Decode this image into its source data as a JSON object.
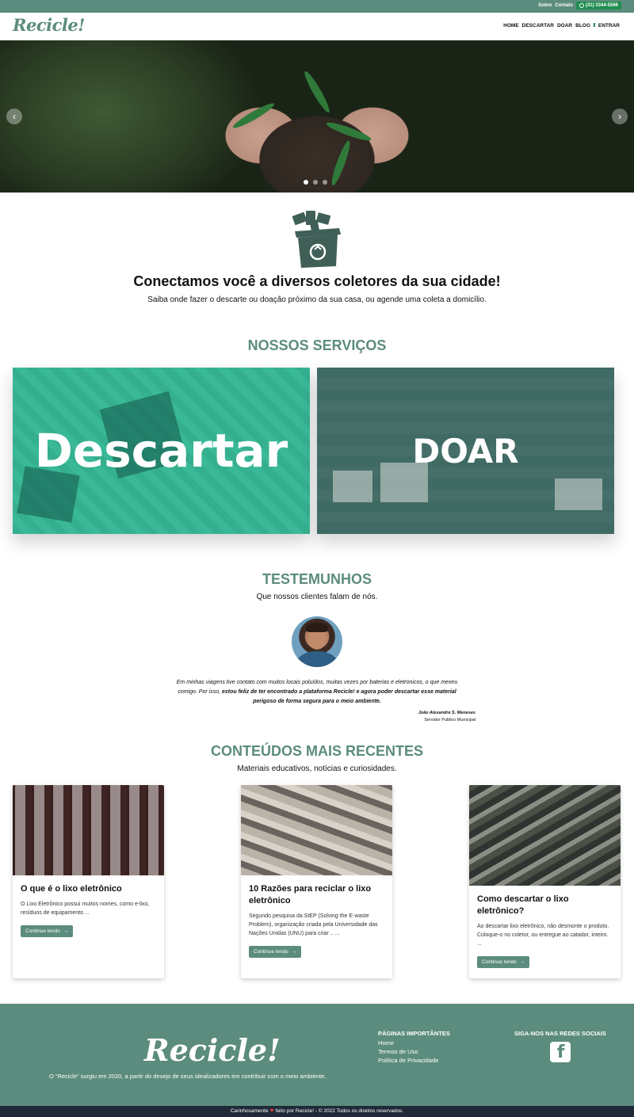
{
  "topbar": {
    "about_label": "Sobre",
    "contact_label": "Contato",
    "phone": "(31) 3344-5566",
    "phone_icon": "whatsapp-icon"
  },
  "navbar": {
    "logo": "Recicle!",
    "links": [
      "HOME",
      "DESCARTAR",
      "DOAR",
      "BLOG",
      "ENTRAR"
    ],
    "enter_icon": "sign-in-icon"
  },
  "hero": {
    "slides_count": 3,
    "active_slide": 1,
    "prev_icon": "chevron-left-icon",
    "next_icon": "chevron-right-icon",
    "prev_glyph": "‹",
    "next_glyph": "›"
  },
  "connect": {
    "title": "Conectamos você a diversos coletores da sua cidade!",
    "subtitle": "Saiba onde fazer o descarte ou doação próximo da sua casa, ou agende uma coleta a domicílio."
  },
  "services": {
    "title": "NOSSOS SERVIÇOS",
    "items": [
      {
        "label": "Descartar",
        "color": "#40cda5"
      },
      {
        "label": "DOAR",
        "color": "#396760"
      }
    ]
  },
  "testimonials": {
    "title": "TESTEMUNHOS",
    "subtitle": "Que nossos clientes falam de nós.",
    "quote_start": "Em minhas viagens tive contato com muitos locais poluídos, muitas vezes por baterias e eletronicos, o que mexeu comigo. Por isso, ",
    "quote_bold": "estou feliz de ter encontrado a plataforma Recicle! e agora poder descartar esse material perigoso de forma segura para o meio ambiente.",
    "author_name": "João Alexandre S. Meneses",
    "author_role": "Servidor Publico Municipal"
  },
  "content": {
    "title": "CONTEÚDOS MAIS RECENTES",
    "subtitle": "Materiais educativos, notícias e curiosidades.",
    "cards": [
      {
        "title": "O que é o lixo eletrônico",
        "text": "O Lixo Eletrônico possui muitos nomes, como e-lixo, resíduos de equipamento ...",
        "button": "Continue lendo"
      },
      {
        "title": "10 Razões para reciclar o lixo eletrônico",
        "text": "Segundo pesquisa da StEP (Solving the E-waste Problem), organização criada pela Universidade das Nações Unidas (UNU) para criar .. ...",
        "button": "Continue lendo"
      },
      {
        "title": "Como descartar o lixo eletrônico?",
        "text": "Ao descartar lixo eletrônico, não desmonte o produto. Coloque-o no coletor, ou entregue ao catador, inteiro. ...",
        "button": "Continue lendo"
      }
    ]
  },
  "footer": {
    "logo": "Recicle!",
    "about": "O “Recicle” surgiu em 2020, a partir do desejo de seus idealizadores em contribuir com o meio ambiente.",
    "pages_title": "PÁGINAS IMPORTÂNTES",
    "pages": [
      "Home",
      "Termos de Uso",
      "Política de Privacidade"
    ],
    "social_title": "SIGA-NOS NAS REDES SOCIAIS",
    "social_icon": "facebook-icon",
    "copyright_start": "Carinhosamente",
    "copyright_end": "feito por Recicle! - © 2022 Todos os direitos reservados.",
    "heart": "❤"
  },
  "colors": {
    "brand": "#5c8c7e",
    "whatsapp": "#1f8f4f",
    "bottom_bar": "#1f2937"
  }
}
